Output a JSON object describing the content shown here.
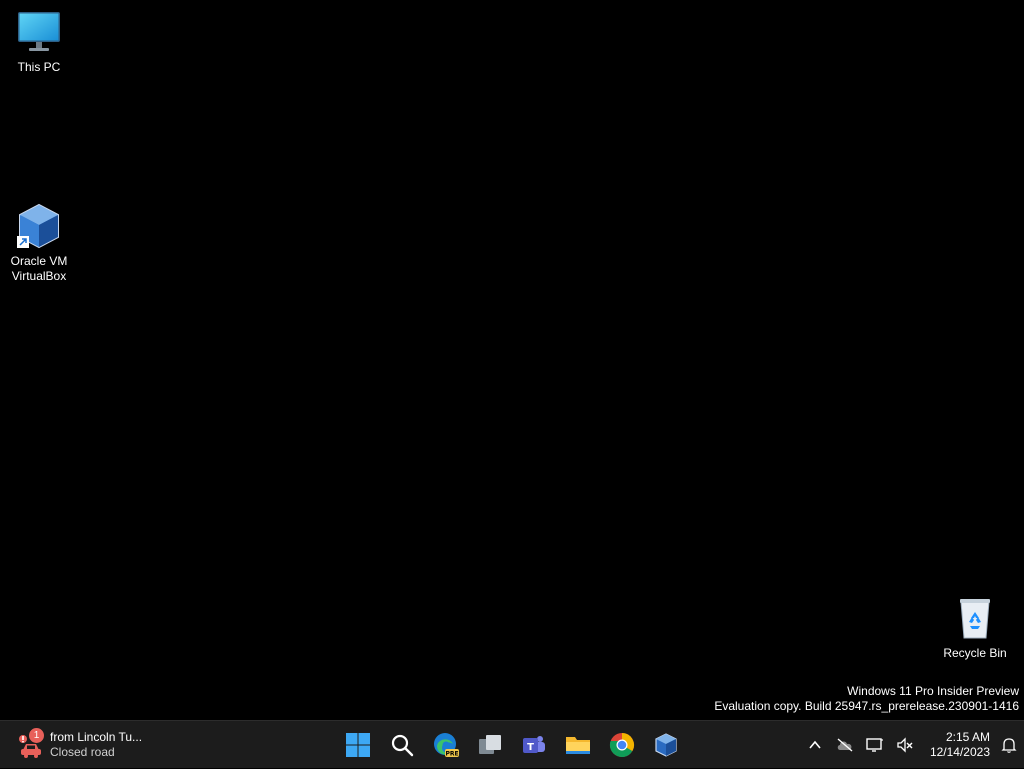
{
  "desktop": {
    "icons": [
      {
        "label": "This PC",
        "icon": "monitor-icon"
      },
      {
        "label": "Oracle VM\nVirtualBox",
        "icon": "virtualbox-icon"
      },
      {
        "label": "Recycle Bin",
        "icon": "recycle-bin-icon"
      }
    ],
    "watermark": {
      "line1": "Windows 11 Pro Insider Preview",
      "line2": "Evaluation copy. Build 25947.rs_prerelease.230901-1416"
    }
  },
  "taskbar": {
    "widget": {
      "badge": "1",
      "title": "from Lincoln Tu...",
      "subtitle": "Closed road",
      "icon": "traffic-car-icon"
    },
    "apps": [
      {
        "name": "start-button",
        "icon": "windows-logo-icon"
      },
      {
        "name": "search-button",
        "icon": "search-icon"
      },
      {
        "name": "edge-beta-button",
        "icon": "edge-icon",
        "badge": "PRE"
      },
      {
        "name": "task-view-button",
        "icon": "task-view-icon"
      },
      {
        "name": "teams-button",
        "icon": "teams-icon"
      },
      {
        "name": "file-explorer-button",
        "icon": "folder-icon"
      },
      {
        "name": "chrome-button",
        "icon": "chrome-icon"
      },
      {
        "name": "virtualbox-button",
        "icon": "virtualbox-icon"
      }
    ],
    "tray": {
      "time": "2:15 AM",
      "date": "12/14/2023"
    },
    "colors": {
      "taskbar_bg": "#1c1c1c",
      "desktop_bg": "#000000",
      "accent_blue": "#1e90ff"
    }
  }
}
